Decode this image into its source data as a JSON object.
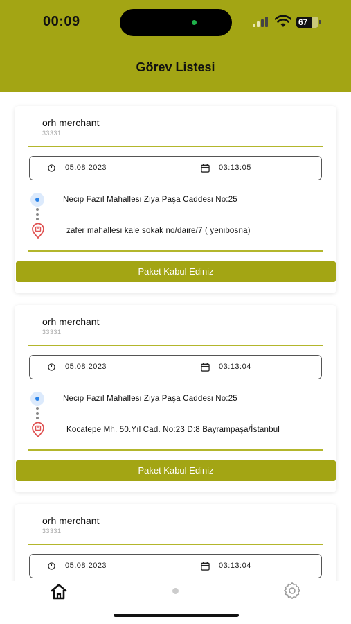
{
  "status_bar": {
    "time": "00:09",
    "battery": "67"
  },
  "header": {
    "title": "Görev Listesi"
  },
  "colors": {
    "accent": "#a3a514",
    "divider": "#b3b62c",
    "pickup": "#2a83e8",
    "dropoff": "#e05252"
  },
  "tasks": [
    {
      "merchant": "orh merchant",
      "code": "33331",
      "date": "05.08.2023",
      "time": "03:13:05",
      "pickup_address": "Necip Fazıl Mahallesi Ziya Paşa Caddesi No:25",
      "dropoff_address": "zafer mahallesi kale sokak no/daire/7 ( yenibosna)",
      "button_label": "Paket Kabul Ediniz"
    },
    {
      "merchant": "orh merchant",
      "code": "33331",
      "date": "05.08.2023",
      "time": "03:13:04",
      "pickup_address": "Necip Fazıl Mahallesi Ziya Paşa Caddesi No:25",
      "dropoff_address": "Kocatepe Mh. 50.Yıl Cad. No:23 D:8 Bayrampaşa/İstanbul",
      "button_label": "Paket Kabul Ediniz"
    },
    {
      "merchant": "orh merchant",
      "code": "33331",
      "date": "05.08.2023",
      "time": "03:13:04"
    }
  ],
  "tabbar": {
    "items": [
      "home-icon",
      "dot",
      "gear-icon"
    ]
  }
}
